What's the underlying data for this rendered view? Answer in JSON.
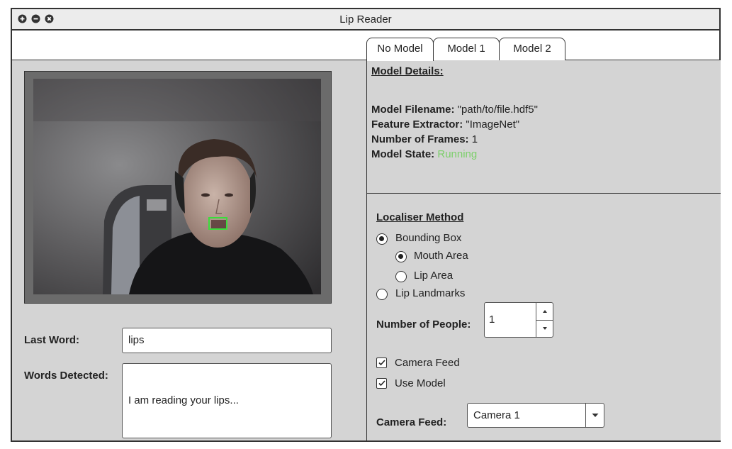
{
  "window": {
    "title": "Lip Reader",
    "controls": [
      "plus-icon",
      "minus-icon",
      "close-icon"
    ]
  },
  "tabs": [
    {
      "label": "No Model",
      "selected": true
    },
    {
      "label": "Model 1",
      "selected": false
    },
    {
      "label": "Model 2",
      "selected": false
    }
  ],
  "details": {
    "heading": "Model Details:",
    "filename_label": "Model Filename:",
    "filename_value": "\"path/to/file.hdf5\"",
    "extractor_label": "Feature Extractor:",
    "extractor_value": "\"ImageNet\"",
    "frames_label": "Number of Frames:",
    "frames_value": "1",
    "state_label": "Model State:",
    "state_value": "Running",
    "state_color": "#7ccf6a"
  },
  "localiser": {
    "heading": "Localiser Method",
    "options": [
      {
        "label": "Bounding Box",
        "selected": true
      },
      {
        "label": "Mouth Area",
        "selected": true
      },
      {
        "label": "Lip Area",
        "selected": false
      },
      {
        "label": "Lip Landmarks",
        "selected": false
      }
    ]
  },
  "people": {
    "label": "Number of People:",
    "value": "1"
  },
  "checkboxes": [
    {
      "label": "Camera Feed",
      "checked": true
    },
    {
      "label": "Use Model",
      "checked": true
    }
  ],
  "camera": {
    "label": "Camera Feed:",
    "selected": "Camera 1"
  },
  "output": {
    "last_word_label": "Last Word:",
    "last_word_value": "lips",
    "words_label": "Words Detected:",
    "words_value": "I am reading your lips..."
  },
  "colors": {
    "panel": "#d4d4d4",
    "detection_box": "#3cdc3c"
  }
}
